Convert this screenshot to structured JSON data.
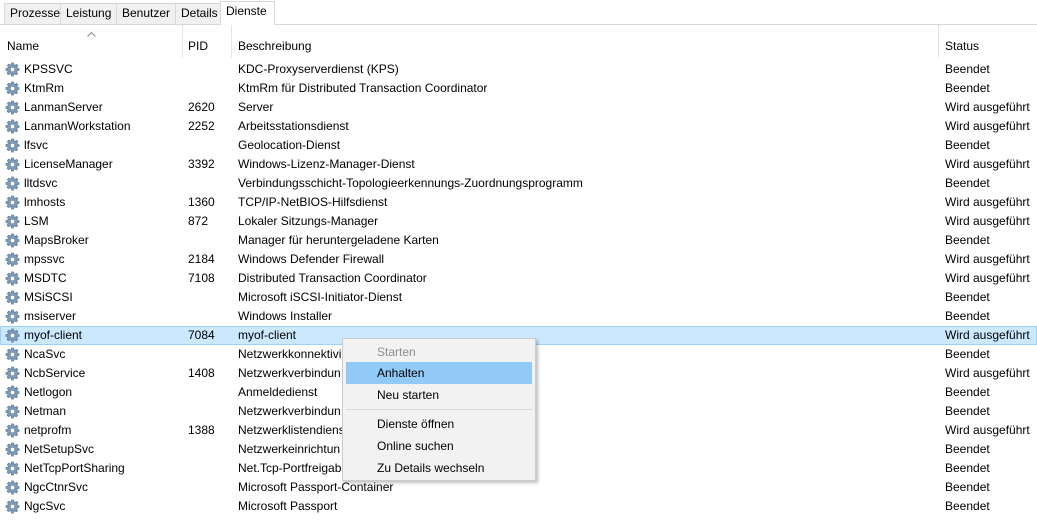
{
  "tabs": [
    {
      "label": "Prozesse",
      "active": false
    },
    {
      "label": "Leistung",
      "active": false
    },
    {
      "label": "Benutzer",
      "active": false
    },
    {
      "label": "Details",
      "active": false
    },
    {
      "label": "Dienste",
      "active": true
    }
  ],
  "columns": {
    "name": "Name",
    "pid": "PID",
    "desc": "Beschreibung",
    "status": "Status"
  },
  "sort_icon": "sort-ascending-icon",
  "services": [
    {
      "name": "KPSSVC",
      "pid": "",
      "desc": "KDC-Proxyserverdienst (KPS)",
      "status": "Beendet"
    },
    {
      "name": "KtmRm",
      "pid": "",
      "desc": "KtmRm für Distributed Transaction Coordinator",
      "status": "Beendet"
    },
    {
      "name": "LanmanServer",
      "pid": "2620",
      "desc": "Server",
      "status": "Wird ausgeführt"
    },
    {
      "name": "LanmanWorkstation",
      "pid": "2252",
      "desc": "Arbeitsstationsdienst",
      "status": "Wird ausgeführt"
    },
    {
      "name": "lfsvc",
      "pid": "",
      "desc": "Geolocation-Dienst",
      "status": "Beendet"
    },
    {
      "name": "LicenseManager",
      "pid": "3392",
      "desc": "Windows-Lizenz-Manager-Dienst",
      "status": "Wird ausgeführt"
    },
    {
      "name": "lltdsvc",
      "pid": "",
      "desc": "Verbindungsschicht-Topologieerkennungs-Zuordnungsprogramm",
      "status": "Beendet"
    },
    {
      "name": "lmhosts",
      "pid": "1360",
      "desc": "TCP/IP-NetBIOS-Hilfsdienst",
      "status": "Wird ausgeführt"
    },
    {
      "name": "LSM",
      "pid": "872",
      "desc": "Lokaler Sitzungs-Manager",
      "status": "Wird ausgeführt"
    },
    {
      "name": "MapsBroker",
      "pid": "",
      "desc": "Manager für heruntergeladene Karten",
      "status": "Beendet"
    },
    {
      "name": "mpssvc",
      "pid": "2184",
      "desc": "Windows Defender Firewall",
      "status": "Wird ausgeführt"
    },
    {
      "name": "MSDTC",
      "pid": "7108",
      "desc": "Distributed Transaction Coordinator",
      "status": "Wird ausgeführt"
    },
    {
      "name": "MSiSCSI",
      "pid": "",
      "desc": "Microsoft iSCSI-Initiator-Dienst",
      "status": "Beendet"
    },
    {
      "name": "msiserver",
      "pid": "",
      "desc": "Windows Installer",
      "status": "Beendet"
    },
    {
      "name": "myof-client",
      "pid": "7084",
      "desc": "myof-client",
      "status": "Wird ausgeführt",
      "selected": true
    },
    {
      "name": "NcaSvc",
      "pid": "",
      "desc": "Netzwerkkonnektivi",
      "status": "Beendet"
    },
    {
      "name": "NcbService",
      "pid": "1408",
      "desc": "Netzwerkverbindun",
      "status": "Wird ausgeführt"
    },
    {
      "name": "Netlogon",
      "pid": "",
      "desc": "Anmeldedienst",
      "status": "Beendet"
    },
    {
      "name": "Netman",
      "pid": "",
      "desc": "Netzwerkverbindun",
      "status": "Beendet"
    },
    {
      "name": "netprofm",
      "pid": "1388",
      "desc": "Netzwerklistendiens",
      "status": "Wird ausgeführt"
    },
    {
      "name": "NetSetupSvc",
      "pid": "",
      "desc": "Netzwerkeinrichtun",
      "status": "Beendet"
    },
    {
      "name": "NetTcpPortSharing",
      "pid": "",
      "desc": "Net.Tcp-Portfreigab",
      "status": "Beendet"
    },
    {
      "name": "NgcCtnrSvc",
      "pid": "",
      "desc": "Microsoft Passport-Container",
      "status": "Beendet"
    },
    {
      "name": "NgcSvc",
      "pid": "",
      "desc": "Microsoft Passport",
      "status": "Beendet"
    }
  ],
  "service_icon": "service-gear-icon",
  "context_menu": {
    "items": [
      {
        "label": "Starten",
        "disabled": true,
        "highlighted": false
      },
      {
        "label": "Anhalten",
        "disabled": false,
        "highlighted": true
      },
      {
        "label": "Neu starten",
        "disabled": false,
        "highlighted": false
      },
      {
        "label": "Dienste öffnen",
        "disabled": false,
        "highlighted": false
      },
      {
        "label": "Online suchen",
        "disabled": false,
        "highlighted": false
      },
      {
        "label": "Zu Details wechseln",
        "disabled": false,
        "highlighted": false
      }
    ]
  },
  "colors": {
    "selection": "#cce8ff",
    "menu_highlight": "#91c9f7",
    "disabled_text": "#8c8c8c"
  }
}
